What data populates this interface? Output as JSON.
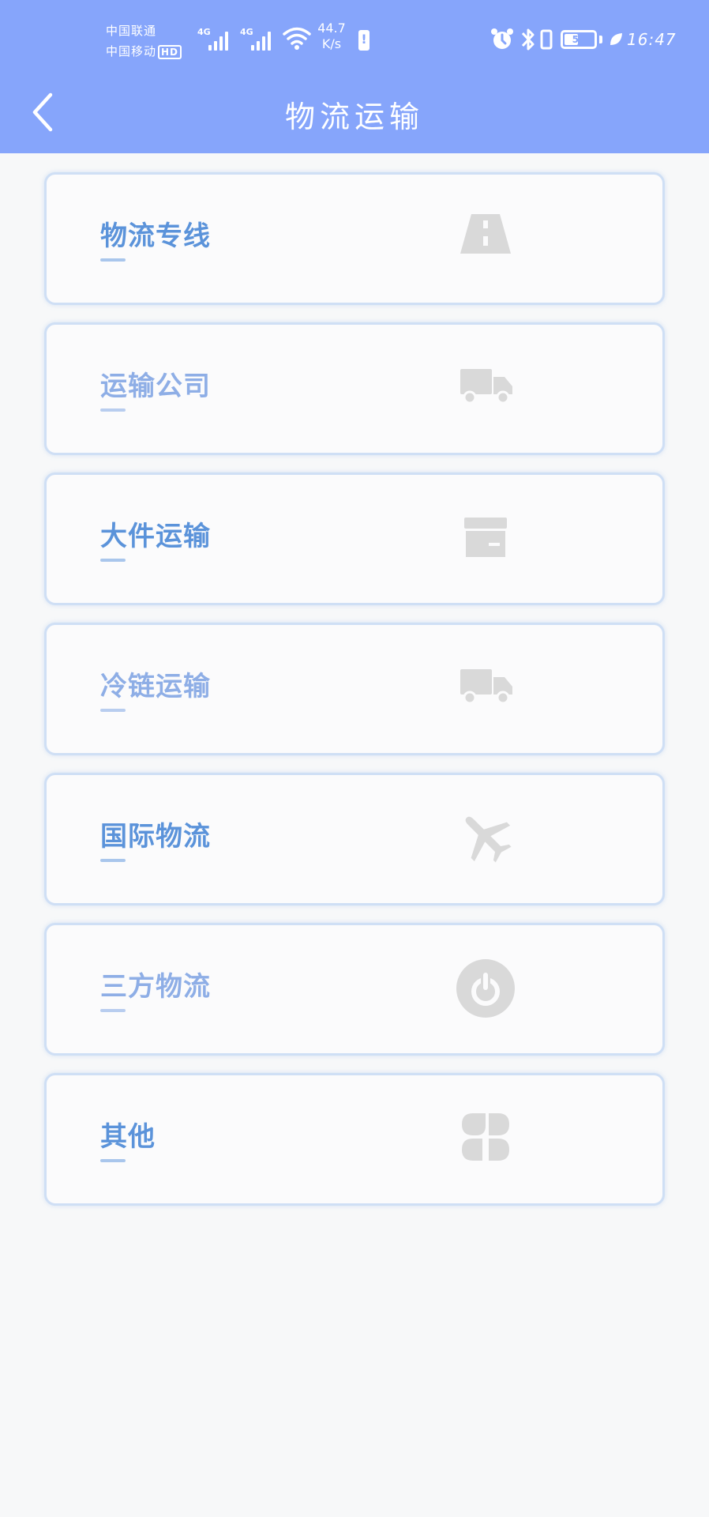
{
  "status_bar": {
    "carrier_1": "中国联通",
    "carrier_2": "中国移动",
    "hd_badge": "HD",
    "network_1": "4G",
    "network_2": "4G",
    "speed_value": "44.7",
    "speed_unit": "K/s",
    "battery_percent": "50",
    "time": "16:47"
  },
  "header": {
    "title": "物流运输"
  },
  "colors": {
    "header_bg": "#86a5fb",
    "label_strong": "#5b93da",
    "label_soft": "#8eaee6",
    "icon_gray": "#d9d9d9"
  },
  "items": [
    {
      "label": "物流专线",
      "icon": "road-icon",
      "style": "strong"
    },
    {
      "label": "运输公司",
      "icon": "truck-icon",
      "style": "soft"
    },
    {
      "label": "大件运输",
      "icon": "box-icon",
      "style": "strong"
    },
    {
      "label": "冷链运输",
      "icon": "truck-icon",
      "style": "soft"
    },
    {
      "label": "国际物流",
      "icon": "airplane-icon",
      "style": "strong"
    },
    {
      "label": "三方物流",
      "icon": "power-icon",
      "style": "soft"
    },
    {
      "label": "其他",
      "icon": "four-leaf-icon",
      "style": "strong"
    }
  ]
}
